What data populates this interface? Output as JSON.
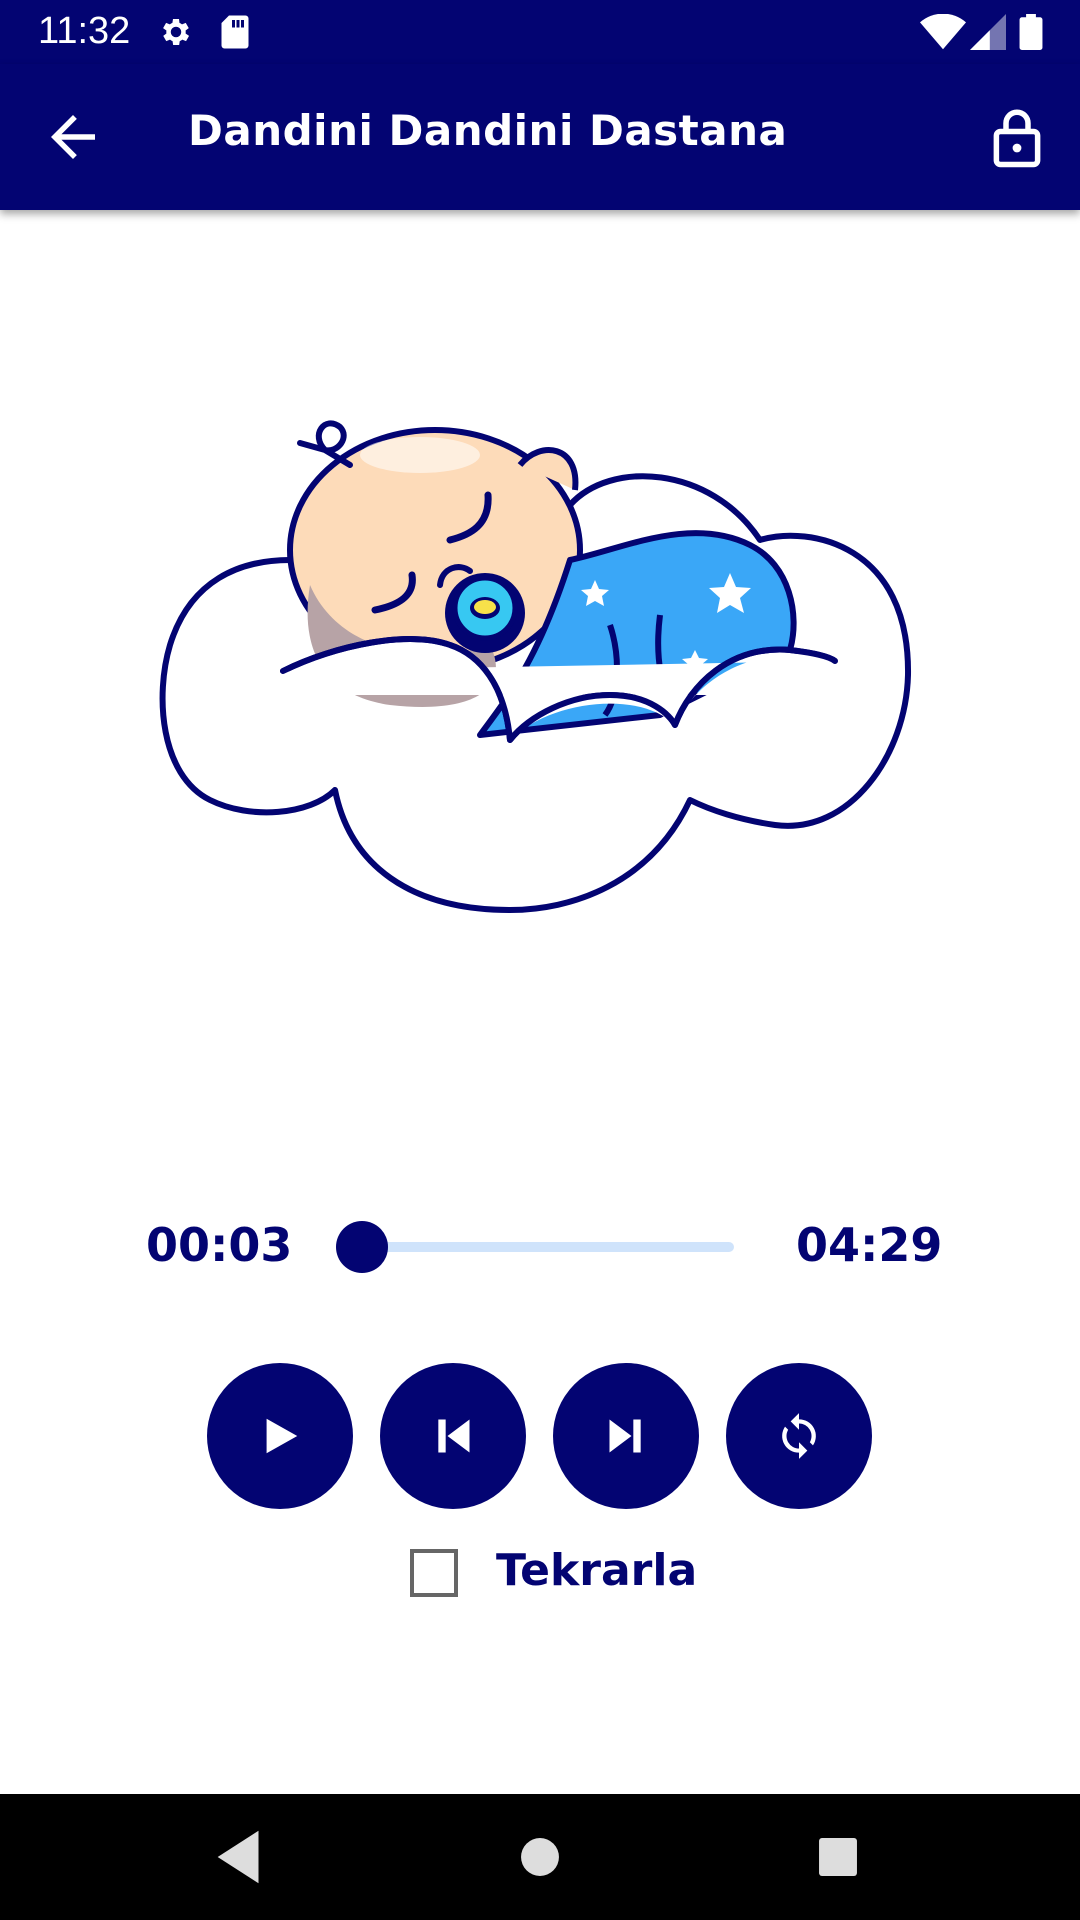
{
  "status_bar": {
    "time": "11:32",
    "icons": [
      "settings-icon",
      "sd-card-icon",
      "wifi-icon",
      "cell-signal-icon",
      "battery-icon"
    ]
  },
  "app_bar": {
    "title": "Dandini Dandini Dastana",
    "back_icon": "arrow-back-icon",
    "lock_icon": "lock-open-icon"
  },
  "artwork": {
    "description_icon": "sleeping-baby-on-cloud-illustration"
  },
  "player": {
    "current_time": "00:03",
    "total_time": "04:29",
    "progress": 0.011,
    "controls": [
      {
        "name": "play",
        "icon": "play-icon"
      },
      {
        "name": "previous",
        "icon": "skip-previous-icon"
      },
      {
        "name": "next",
        "icon": "skip-next-icon"
      },
      {
        "name": "loop",
        "icon": "repeat-icon"
      }
    ],
    "repeat_label": "Tekrarla",
    "repeat_checked": false
  },
  "colors": {
    "primary": "#030472",
    "track": "#cfe3fb",
    "background": "#ffffff",
    "baby_blanket": "#3aa7f7",
    "baby_skin": "#fddbb9"
  },
  "nav_bar": {
    "icons": [
      "nav-back-icon",
      "nav-home-icon",
      "nav-recents-icon"
    ]
  }
}
